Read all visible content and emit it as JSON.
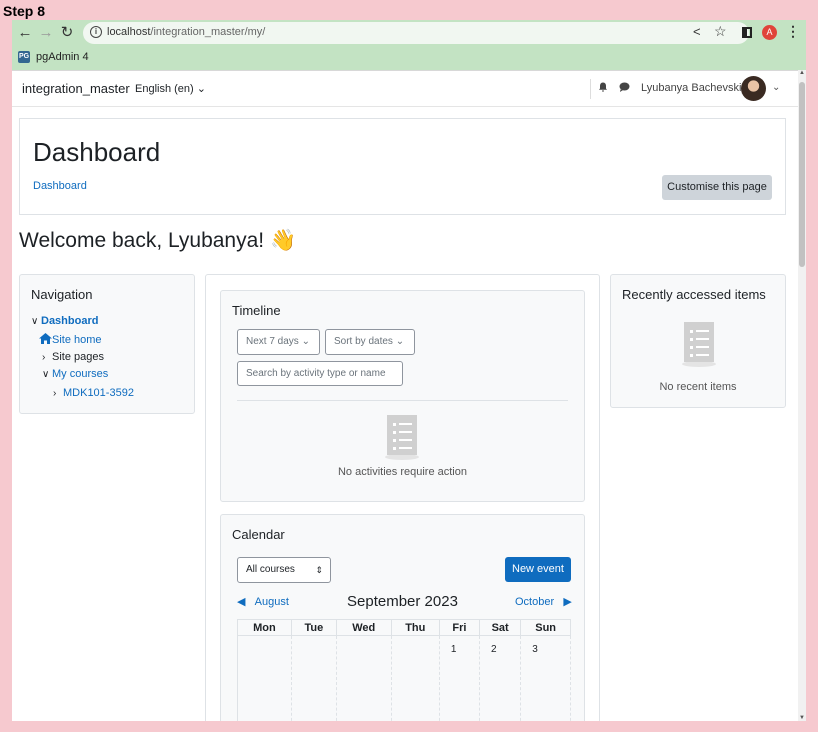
{
  "step_label": "Step 8",
  "browser": {
    "url_host": "localhost",
    "url_path": "/integration_master/my/",
    "profile_initial": "A",
    "bookmark_label": "pgAdmin 4",
    "bookmark_icon_text": "PG"
  },
  "topnav": {
    "site_name": "integration_master",
    "language": "English (en)",
    "user_name": "Lyubanya Bachevskiy"
  },
  "header": {
    "title": "Dashboard",
    "breadcrumb": "Dashboard",
    "customise_label": "Customise this page"
  },
  "welcome": "Welcome back, Lyubanya! 👋",
  "navigation": {
    "title": "Navigation",
    "items": [
      "Dashboard",
      "Site home",
      "Site pages",
      "My courses",
      "MDK101-3592"
    ]
  },
  "timeline": {
    "title": "Timeline",
    "range_select": "Next 7 days",
    "sort_select": "Sort by dates",
    "search_placeholder": "Search by activity type or name",
    "empty_text": "No activities require action"
  },
  "calendar": {
    "title": "Calendar",
    "course_select": "All courses",
    "new_event_label": "New event",
    "prev_month": "August",
    "next_month": "October",
    "current_month": "September 2023",
    "weekdays": [
      "Mon",
      "Tue",
      "Wed",
      "Thu",
      "Fri",
      "Sat",
      "Sun"
    ],
    "first_week": [
      "",
      "",
      "",
      "",
      "1",
      "2",
      "3"
    ]
  },
  "recent": {
    "title": "Recently accessed items",
    "empty_text": "No recent items"
  },
  "colors": {
    "brand_blue": "#0f6cbf",
    "chrome_green": "#c3e3c3",
    "frame_pink": "#f6c9cf"
  }
}
